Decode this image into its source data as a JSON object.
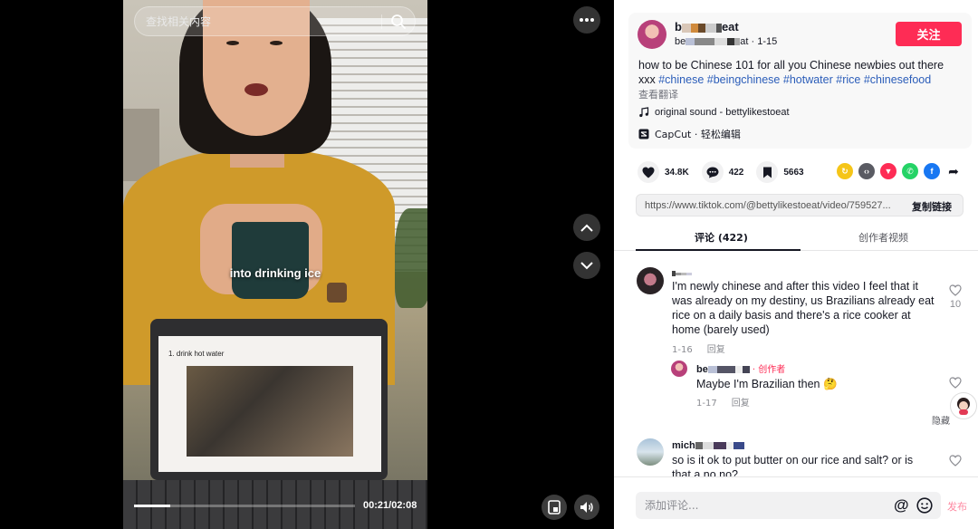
{
  "search": {
    "placeholder": "查找相关内容"
  },
  "video": {
    "caption": "into drinking ice",
    "slide_text": "1.   drink hot water",
    "time": "00:21/02:08",
    "progress": 0.164
  },
  "author": {
    "name_prefix": "b",
    "name_suffix": "eat",
    "handle_prefix": "be",
    "handle_suffix": "at",
    "date": "· 1-15",
    "follow_label": "关注"
  },
  "description": {
    "text": "how to be Chinese 101 for all you Chinese newbies out there xxx ",
    "hashtags": [
      "#chinese",
      "#beingchinese",
      "#hotwater",
      "#rice",
      "#chinesefood"
    ],
    "translate_label": "查看翻译"
  },
  "sound": {
    "label": "original sound - bettylikestoeat"
  },
  "capcut": {
    "label": "CapCut · 轻松编辑"
  },
  "stats": {
    "likes": "34.8K",
    "comments": "422",
    "saves": "5663"
  },
  "share_link": {
    "url": "https://www.tiktok.com/@bettylikestoeat/video/759527...",
    "copy_label": "复制链接"
  },
  "tabs": {
    "comments": "评论 (422)",
    "creator_videos": "创作者视频"
  },
  "comments": [
    {
      "text": "I'm newly chinese and after this video I feel that it was already on my destiny, us Brazilians already eat rice on a daily basis and there's a rice cooker at home (barely used)",
      "date": "1-16",
      "reply_label": "回复",
      "likes": "10"
    }
  ],
  "reply": {
    "name_prefix": "be",
    "creator_label": "· 创作者",
    "text": "Maybe I'm Brazilian then 🤔",
    "date": "1-17",
    "reply_label": "回复"
  },
  "hide_label": "隐藏",
  "comment2": {
    "name_prefix": "mich",
    "text": "so is it ok to put butter on our rice and salt? or is that a no no?"
  },
  "comment_box": {
    "placeholder": "添加评论...",
    "at_symbol": "@",
    "post_label": "发布"
  },
  "colors": {
    "accent": "#fe2c55",
    "hashtag": "#2b5db9",
    "sweater": "#cf9a2a"
  }
}
